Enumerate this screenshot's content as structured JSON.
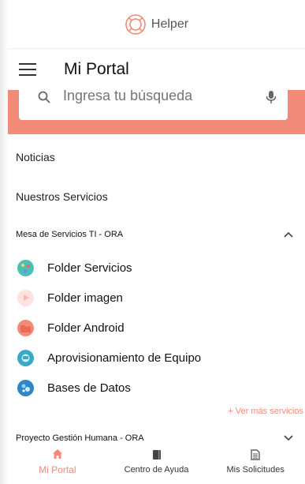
{
  "brand": {
    "name": "Helper",
    "logo_icon": "helper-logo-icon"
  },
  "header": {
    "title": "Mi Portal",
    "menu_icon": "hamburger-icon"
  },
  "search": {
    "placeholder": "Ingresa tu búsqueda",
    "value": "",
    "search_icon": "search-icon",
    "voice_icon": "microphone-icon"
  },
  "menu": [
    {
      "label": "Noticias"
    },
    {
      "label": "Nuestros Servicios"
    }
  ],
  "sections": [
    {
      "title": "Mesa de Servicios TI - ORA",
      "expanded": true,
      "items": [
        {
          "label": "Folder Servicios",
          "icon": "folder-servicios-icon",
          "color": "#4dbfb6"
        },
        {
          "label": "Folder imagen",
          "icon": "folder-imagen-icon",
          "color": "#fde3df"
        },
        {
          "label": "Folder Android",
          "icon": "folder-android-icon",
          "color": "#f28a78"
        },
        {
          "label": "Aprovisionamiento de Equipo",
          "icon": "equipment-icon",
          "color": "#3aa9c9"
        },
        {
          "label": "Bases de Datos",
          "icon": "database-icon",
          "color": "#2f86c6"
        }
      ],
      "more_label": "+ Ver más servicios"
    },
    {
      "title": "Proyecto Gestión Humana - ORA",
      "expanded": false
    }
  ],
  "tabs": [
    {
      "label": "Mi Portal",
      "icon": "home-icon",
      "active": true
    },
    {
      "label": "Centro de Ayuda",
      "icon": "book-icon",
      "active": false
    },
    {
      "label": "Mis Solicitudes",
      "icon": "document-icon",
      "active": false
    }
  ],
  "colors": {
    "accent": "#f28a78",
    "text": "#222222"
  }
}
